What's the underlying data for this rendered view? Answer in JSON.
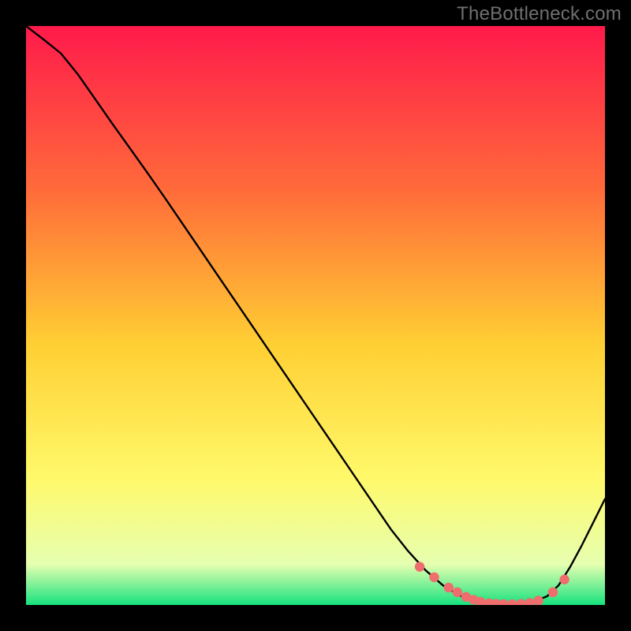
{
  "watermark": "TheBottleneck.com",
  "colors": {
    "frame": "#000000",
    "watermark_text": "#707070",
    "gradient_top": "#ff1a4b",
    "gradient_upper": "#ff6a3a",
    "gradient_mid": "#ffcf33",
    "gradient_low": "#fff96a",
    "gradient_pale": "#e6ffb0",
    "gradient_bottom": "#17e27e",
    "curve": "#000000",
    "marker_fill": "#ef6d6d",
    "marker_stroke": "#d65252"
  },
  "chart_data": {
    "type": "line",
    "title": "",
    "xlabel": "",
    "ylabel": "",
    "xlim": [
      0,
      100
    ],
    "ylim": [
      0,
      100
    ],
    "series": [
      {
        "name": "bottleneck-curve",
        "x": [
          0,
          3,
          6,
          9,
          12,
          15,
          18,
          21,
          24,
          27,
          30,
          33,
          36,
          39,
          42,
          45,
          48,
          51,
          54,
          57,
          60,
          63,
          66,
          69,
          72,
          75,
          78,
          80,
          82,
          84,
          86,
          88,
          90,
          92,
          94,
          96,
          98,
          100
        ],
        "y": [
          100,
          97.7,
          95.3,
          91.6,
          87.3,
          83,
          78.8,
          74.6,
          70.3,
          65.9,
          61.5,
          57.1,
          52.7,
          48.3,
          43.9,
          39.5,
          35.1,
          30.7,
          26.3,
          21.9,
          17.5,
          13.1,
          9.3,
          6,
          3.4,
          1.6,
          0.6,
          0.25,
          0.1,
          0.1,
          0.25,
          0.7,
          1.5,
          3.4,
          6.6,
          10.3,
          14.3,
          18.3
        ]
      }
    ],
    "markers": {
      "name": "optimal-band",
      "x": [
        68,
        70.5,
        73,
        74.5,
        76,
        77.3,
        78.5,
        80,
        81.2,
        82.5,
        84,
        85.5,
        87,
        88.5,
        91,
        93
      ],
      "y": [
        6.6,
        4.8,
        3,
        2.2,
        1.4,
        0.9,
        0.55,
        0.3,
        0.2,
        0.15,
        0.15,
        0.2,
        0.35,
        0.75,
        2.2,
        4.4
      ]
    }
  }
}
